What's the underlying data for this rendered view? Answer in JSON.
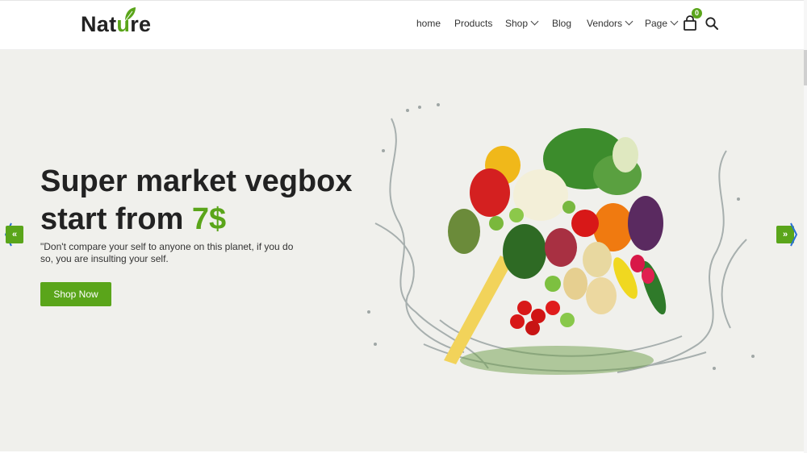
{
  "brand": {
    "pre": "Nat",
    "highlight": "u",
    "post": "re"
  },
  "nav": {
    "items": [
      {
        "label": "home"
      },
      {
        "label": "Products"
      },
      {
        "label": "Shop"
      },
      {
        "label": "Blog"
      },
      {
        "label": "Vendors"
      },
      {
        "label": "Page"
      }
    ],
    "cart_count": "0"
  },
  "hero": {
    "title_line1": "Super market vegbox",
    "title_line2": "start from ",
    "price": "7$",
    "quote": "\"Don't compare your self to anyone on this planet, if you do so, you are insulting your self.",
    "button_label": "Shop Now",
    "prev_label": "«",
    "next_label": "»"
  },
  "colors": {
    "accent": "#5aa51a",
    "hero_bg": "#f0f0ec",
    "text": "#222222"
  },
  "icons": [
    "leaf-icon",
    "chevron-down-icon",
    "shopping-bag-icon",
    "search-icon",
    "double-chevron-left-icon",
    "double-chevron-right-icon"
  ]
}
